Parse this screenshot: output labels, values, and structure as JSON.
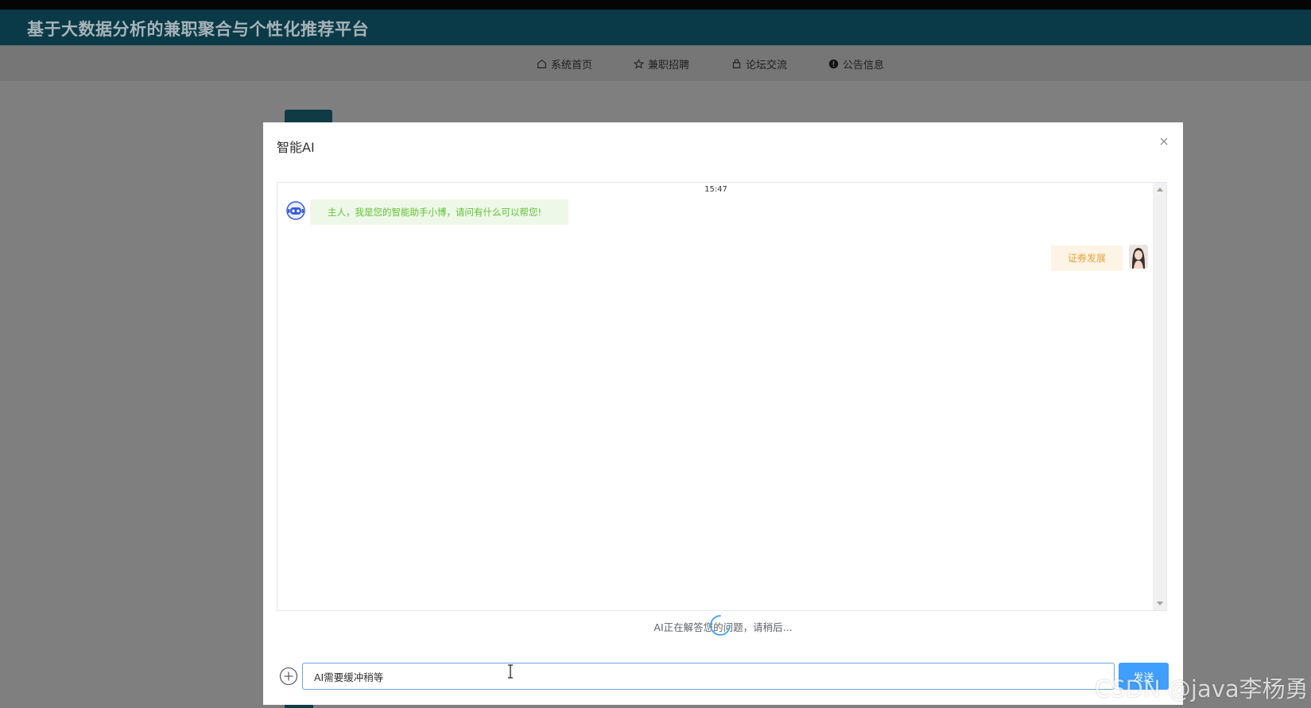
{
  "header": {
    "title": "基于大数据分析的兼职聚合与个性化推荐平台"
  },
  "nav": [
    {
      "label": "系统首页",
      "icon": "home-icon"
    },
    {
      "label": "兼职招聘",
      "icon": "star-icon"
    },
    {
      "label": "论坛交流",
      "icon": "bag-icon"
    },
    {
      "label": "公告信息",
      "icon": "info-circle-icon"
    }
  ],
  "modal": {
    "title": "智能AI",
    "close_icon": "close-icon",
    "chat": {
      "timestamp": "15:47",
      "bot_message": "主人，我是您的智能助手小博，请问有什么可以帮您!",
      "user_message": "证券发展"
    },
    "status_text": "AI正在解答您的问题，请稍后...",
    "input": {
      "value": "AI需要缓冲稍等"
    },
    "send_label": "发送"
  },
  "watermark": "CSDN @java李杨勇",
  "colors": {
    "header_bg": "#0a3a47",
    "bot_bubble_bg": "#eef8e8",
    "bot_text": "#62c13a",
    "user_bubble_bg": "#fdf4e6",
    "user_text": "#e6a23c",
    "primary": "#409eff"
  }
}
